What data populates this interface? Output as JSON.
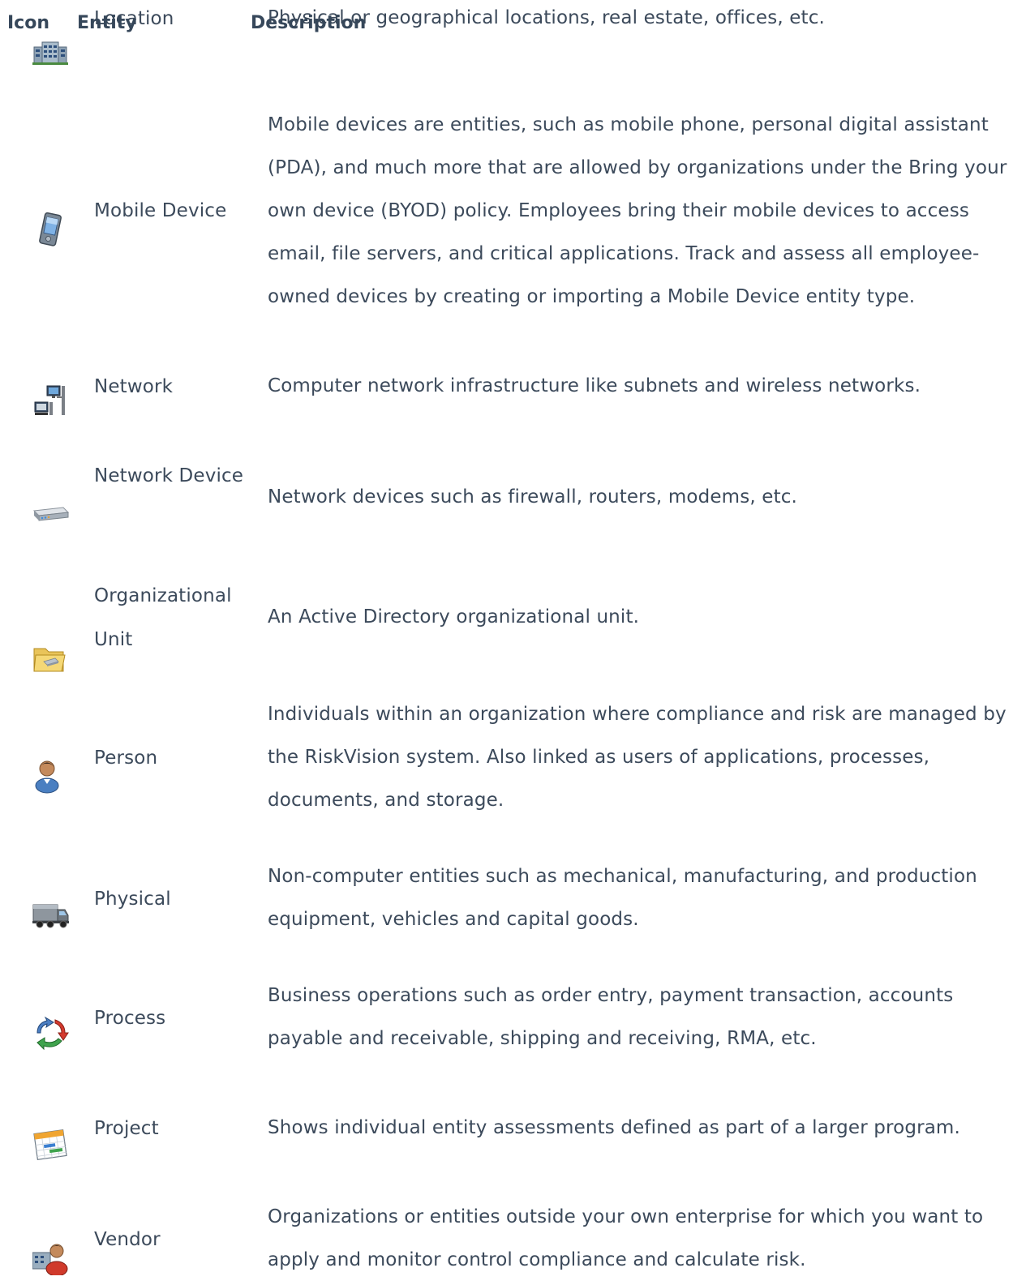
{
  "table": {
    "headers": {
      "icon": "Icon",
      "entity": "Entity",
      "description": "Description"
    },
    "rows": [
      {
        "icon": "building-icon",
        "entity": "Location",
        "description": "Physical or geographical locations, real estate, offices, etc."
      },
      {
        "icon": "mobile-device-icon",
        "entity": "Mobile Device",
        "description": "Mobile devices are entities, such as mobile phone, personal digital assistant (PDA), and much more that are allowed by organizations under the Bring your own device (BYOD) policy. Employees bring their mobile devices to access email, file servers, and critical applications. Track and assess all employee-owned devices by creating or importing a Mobile Device entity type."
      },
      {
        "icon": "network-icon",
        "entity": "Network",
        "description": "Computer network infrastructure like subnets and wireless networks."
      },
      {
        "icon": "network-device-icon",
        "entity": "Network Device",
        "description": "Network devices such as firewall, routers, modems, etc."
      },
      {
        "icon": "folder-icon",
        "entity": "Organizational Unit",
        "description": "An Active Directory organizational unit."
      },
      {
        "icon": "person-icon",
        "entity": "Person",
        "description": "Individuals within an organization where compliance and risk are managed by the RiskVision system. Also linked as users of applications, processes, documents, and storage."
      },
      {
        "icon": "truck-icon",
        "entity": "Physical",
        "description": "Non-computer entities such as mechanical, manufacturing, and production equipment, vehicles and capital goods."
      },
      {
        "icon": "process-cycle-icon",
        "entity": "Process",
        "description": "Business operations such as order entry, payment transaction, accounts payable and receivable, shipping and receiving, RMA, etc."
      },
      {
        "icon": "project-calendar-icon",
        "entity": "Project",
        "description": "Shows individual entity assessments defined as part of a larger program."
      },
      {
        "icon": "vendor-icon",
        "entity": "Vendor",
        "description": "Organizations or entities outside your own enterprise for which you want to apply and monitor control compliance and calculate risk."
      }
    ]
  }
}
